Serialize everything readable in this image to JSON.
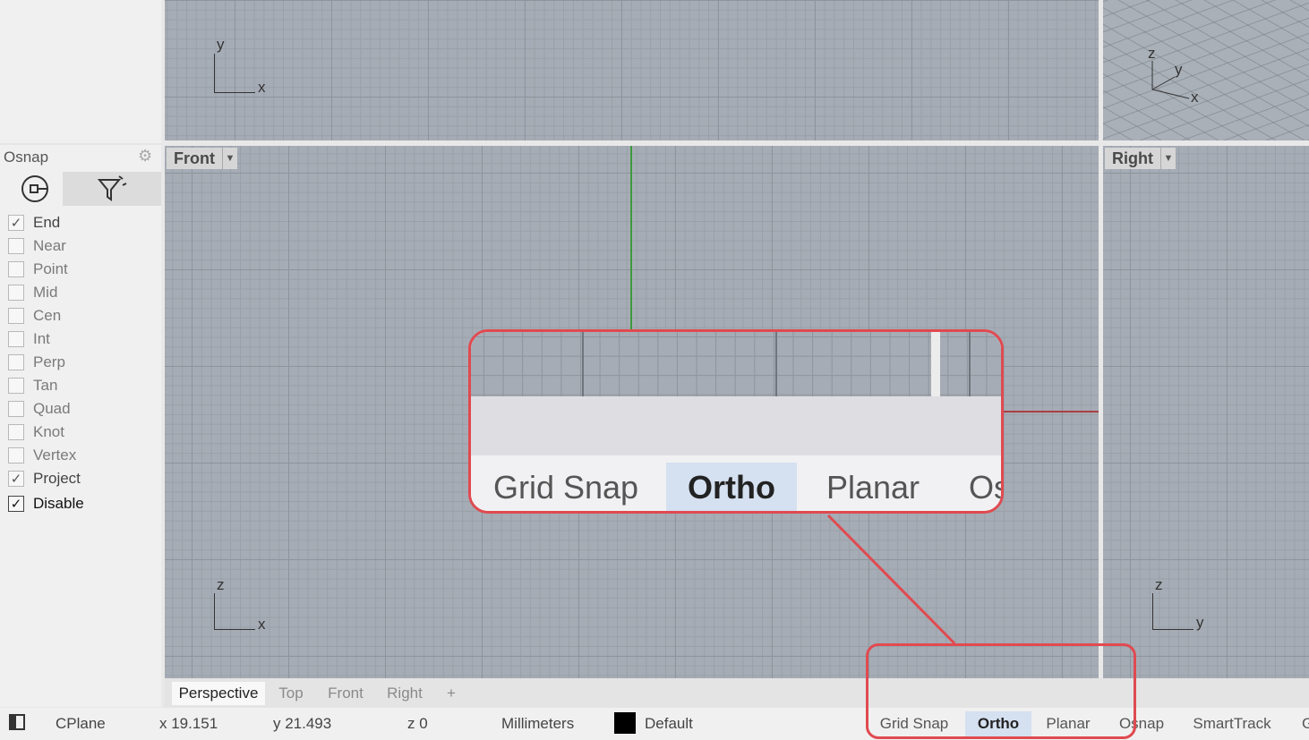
{
  "panel": {
    "title": "Osnap",
    "items": [
      {
        "label": "End",
        "checked": true,
        "mark": "✓"
      },
      {
        "label": "Near",
        "checked": false,
        "mark": ""
      },
      {
        "label": "Point",
        "checked": false,
        "mark": ""
      },
      {
        "label": "Mid",
        "checked": false,
        "mark": ""
      },
      {
        "label": "Cen",
        "checked": false,
        "mark": ""
      },
      {
        "label": "Int",
        "checked": false,
        "mark": ""
      },
      {
        "label": "Perp",
        "checked": false,
        "mark": ""
      },
      {
        "label": "Tan",
        "checked": false,
        "mark": ""
      },
      {
        "label": "Quad",
        "checked": false,
        "mark": ""
      },
      {
        "label": "Knot",
        "checked": false,
        "mark": ""
      },
      {
        "label": "Vertex",
        "checked": false,
        "mark": ""
      },
      {
        "label": "Project",
        "checked": true,
        "mark": "✓"
      },
      {
        "label": "Disable",
        "checked": true,
        "mark": "✓"
      }
    ]
  },
  "viewports": {
    "top": {
      "axis_x": "x",
      "axis_y": "y"
    },
    "perspective": {
      "axis_x": "x",
      "axis_y": "y",
      "axis_z": "z"
    },
    "front": {
      "label": "Front",
      "axis_x": "x",
      "axis_z": "z"
    },
    "right": {
      "label": "Right",
      "axis_y": "y",
      "axis_z": "z"
    }
  },
  "viewport_tabs": [
    "Perspective",
    "Top",
    "Front",
    "Right"
  ],
  "viewport_tabs_add": "+",
  "status": {
    "cplane": "CPlane",
    "x": "x 19.151",
    "y": "y 21.493",
    "z": "z 0",
    "units": "Millimeters",
    "layer": "Default",
    "layer_color": "#000000",
    "panes": [
      "Grid Snap",
      "Ortho",
      "Planar",
      "Osnap",
      "SmartTrack",
      "G"
    ],
    "active_pane": "Ortho"
  },
  "callout": {
    "panes": [
      "Grid Snap",
      "Ortho",
      "Planar",
      "Os"
    ],
    "color": "#e04a50"
  }
}
